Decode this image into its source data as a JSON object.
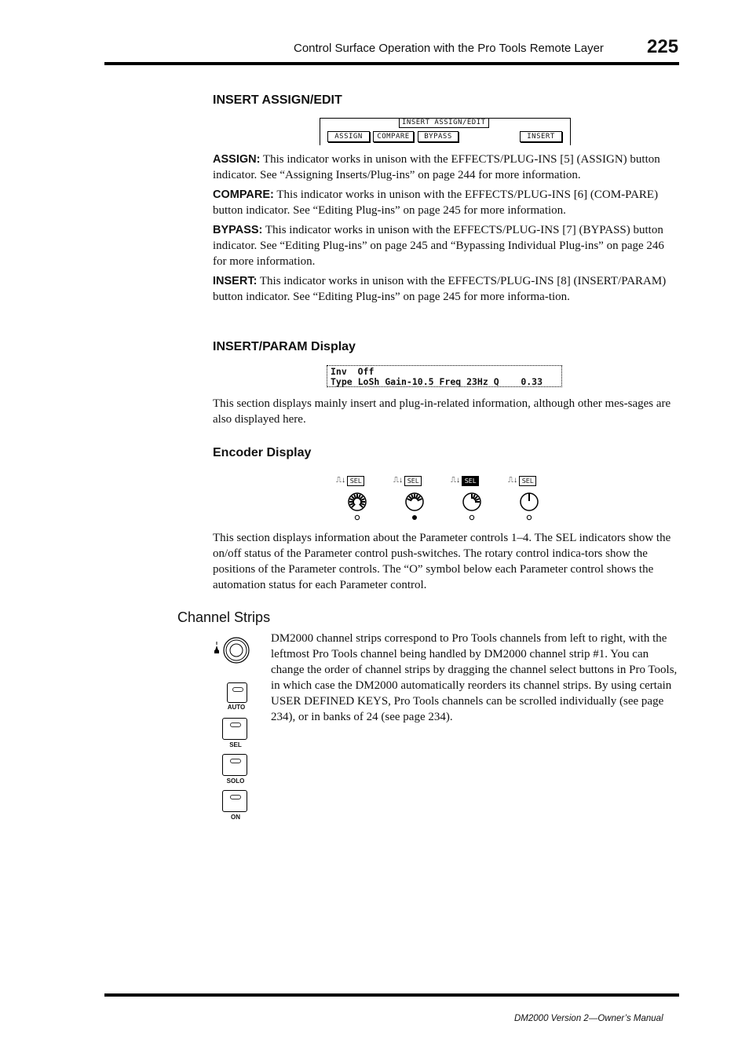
{
  "header": {
    "title": "Control Surface Operation with the Pro Tools Remote Layer",
    "page_number": "225"
  },
  "insert_assign_edit": {
    "heading": "INSERT ASSIGN/EDIT",
    "lcd": {
      "title": "INSERT ASSIGN/EDIT",
      "buttons": [
        "ASSIGN",
        "COMPARE",
        "BYPASS",
        "INSERT"
      ]
    },
    "items": [
      {
        "term": "ASSIGN:",
        "text": "This indicator works in unison with the EFFECTS/PLUG-INS [5] (ASSIGN) button indicator. See “Assigning Inserts/Plug-ins” on page 244 for more information."
      },
      {
        "term": "COMPARE:",
        "text": "This indicator works in unison with the EFFECTS/PLUG-INS [6] (COM-PARE) button indicator. See “Editing Plug-ins” on page 245 for more information."
      },
      {
        "term": "BYPASS:",
        "text": "This indicator works in unison with the EFFECTS/PLUG-INS [7] (BYPASS) button indicator. See “Editing Plug-ins” on page 245 and “Bypassing Individual Plug-ins” on page 246 for more information."
      },
      {
        "term": "INSERT:",
        "text": "This indicator works in unison with the EFFECTS/PLUG-INS [8] (INSERT/PARAM) button indicator. See “Editing Plug-ins” on page 245 for more informa-tion."
      }
    ]
  },
  "insert_param": {
    "heading": "INSERT/PARAM Display",
    "lcd_line1": "Inv  Off",
    "lcd_line2": "Type LoSh Gain-10.5 Freq 23Hz Q    0.33",
    "text": "This section displays mainly insert and plug-in-related information, although other mes-sages are also displayed here."
  },
  "encoder_display": {
    "heading": "Encoder Display",
    "encoders": [
      {
        "sel_label": "SEL",
        "sel_on": false,
        "automation": "open"
      },
      {
        "sel_label": "SEL",
        "sel_on": false,
        "automation": "filled"
      },
      {
        "sel_label": "SEL",
        "sel_on": true,
        "automation": "open"
      },
      {
        "sel_label": "SEL",
        "sel_on": false,
        "automation": "open"
      }
    ],
    "text": "This section displays information about the Parameter controls 1–4. The SEL indicators show the on/off status of the Parameter control push-switches. The rotary control indica-tors show the positions of the Parameter controls. The “O” symbol below each Parameter control shows the automation status for each Parameter control."
  },
  "channel_strips": {
    "heading": "Channel Strips",
    "text": "DM2000 channel strips correspond to Pro Tools channels from left to right, with the leftmost Pro Tools channel being handled by DM2000 channel strip #1. You can change the order of channel strips by dragging the channel select buttons in Pro Tools, in which case the DM2000 automatically reorders its channel strips. By using certain USER DEFINED KEYS, Pro Tools channels can be scrolled individually (see page 234), or in banks of 24 (see page 234).",
    "buttons": [
      "AUTO",
      "SEL",
      "SOLO",
      "ON"
    ]
  },
  "footer": {
    "text": "DM2000 Version 2—Owner’s Manual"
  }
}
